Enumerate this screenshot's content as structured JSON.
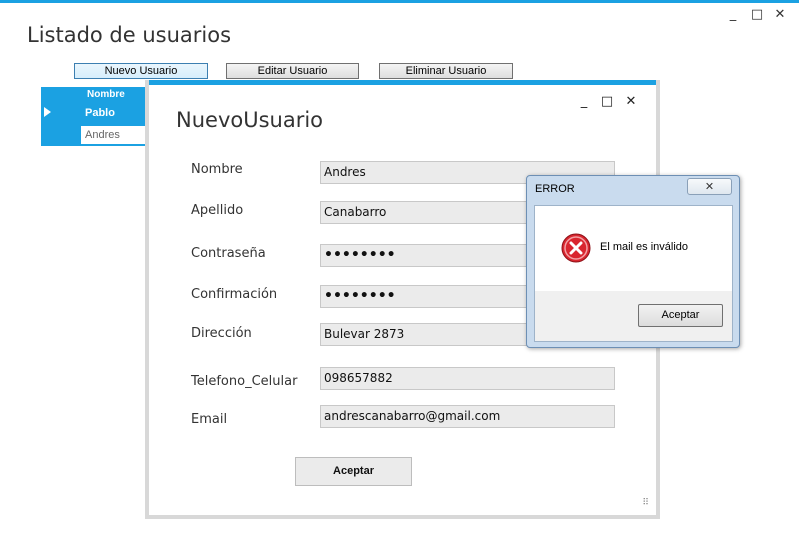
{
  "main_window": {
    "title": "Listado de usuarios",
    "controls": {
      "minimize": "_",
      "maximize": "□",
      "close": "✕"
    },
    "toolbar": {
      "new_user": "Nuevo Usuario",
      "edit_user": "Editar Usuario",
      "delete_user": "Eliminar Usuario"
    },
    "grid": {
      "header": "Nombre",
      "rows": [
        "Pablo",
        "Andres"
      ],
      "selected_row": 0
    }
  },
  "child_window": {
    "title": "NuevoUsuario",
    "controls": {
      "minimize": "_",
      "maximize": "□",
      "close": "✕"
    },
    "fields": {
      "nombre": {
        "label": "Nombre",
        "value": "Andres"
      },
      "apellido": {
        "label": "Apellido",
        "value": "Canabarro"
      },
      "contrasena": {
        "label": "Contraseña",
        "value": "••••••••"
      },
      "confirmacion": {
        "label": "Confirmación",
        "value": "••••••••"
      },
      "direccion": {
        "label": "Dirección",
        "value": "Bulevar 2873"
      },
      "telefono": {
        "label": "Telefono_Celular",
        "value": "098657882"
      },
      "email": {
        "label": "Email",
        "value": "andrescanabarro@gmail.com"
      }
    },
    "accept_button": "Aceptar",
    "resize_grip": "⠿"
  },
  "error_dialog": {
    "title": "ERROR",
    "close": "✕",
    "icon": "error-icon",
    "message": "El mail es inválido",
    "accept_button": "Aceptar"
  },
  "colors": {
    "accent": "#1ba1e2",
    "error_red": "#d9262f",
    "dialog_frame": "#c9dbee"
  }
}
